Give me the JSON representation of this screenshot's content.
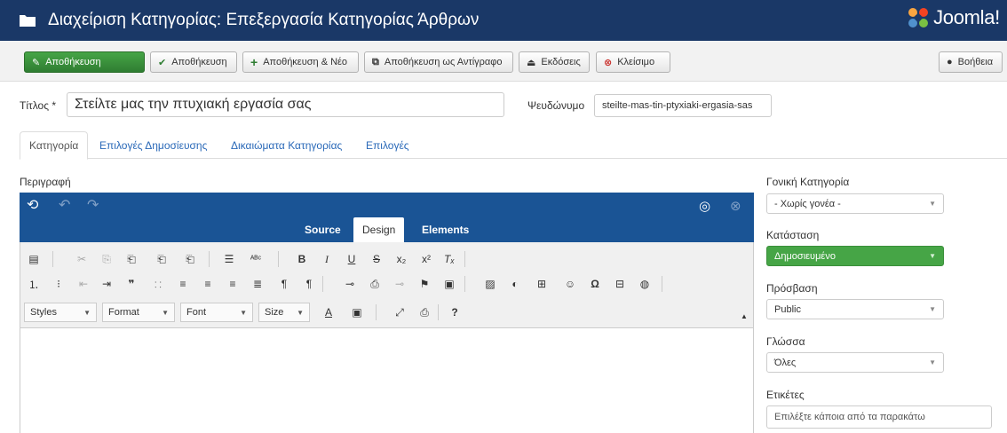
{
  "header": {
    "title": "Διαχείριση Κατηγορίας: Επεξεργασία Κατηγορίας Άρθρων",
    "brand": "Joomla!"
  },
  "toolbar": {
    "save_primary": "Αποθήκευση",
    "save_close": "Αποθήκευση",
    "save_new": "Αποθήκευση & Νέο",
    "save_copy": "Αποθήκευση ως Αντίγραφο",
    "versions": "Εκδόσεις",
    "close": "Κλείσιμο",
    "help": "Βοήθεια"
  },
  "form": {
    "title_label": "Τίτλος *",
    "title_value": "Στείλτε μας την πτυχιακή εργασία σας",
    "alias_label": "Ψευδώνυμο",
    "alias_value": "steilte-mas-tin-ptyxiaki-ergasia-sas"
  },
  "tabs": [
    {
      "label": "Κατηγορία",
      "active": true
    },
    {
      "label": "Επιλογές Δημοσίευσης",
      "active": false
    },
    {
      "label": "Δικαιώματα Κατηγορίας",
      "active": false
    },
    {
      "label": "Επιλογές",
      "active": false
    }
  ],
  "description_label": "Περιγραφή",
  "editor": {
    "tabs": [
      "Source",
      "Design",
      "Elements"
    ],
    "active_tab": "Design",
    "dropdowns": [
      "Styles",
      "Format",
      "Font",
      "Size"
    ]
  },
  "sidebar": {
    "parent_label": "Γονική Κατηγορία",
    "parent_value": "- Χωρίς γονέα -",
    "status_label": "Κατάσταση",
    "status_value": "Δημοσιευμένο",
    "access_label": "Πρόσβαση",
    "access_value": "Public",
    "language_label": "Γλώσσα",
    "language_value": "Όλες",
    "tags_label": "Ετικέτες",
    "tags_placeholder": "Επιλέξτε κάποια από τα παρακάτω"
  },
  "colors": {
    "header_bg": "#1a3867",
    "editor_bg": "#1a5495",
    "primary_green": "#46a546",
    "link_blue": "#2a69b8"
  }
}
